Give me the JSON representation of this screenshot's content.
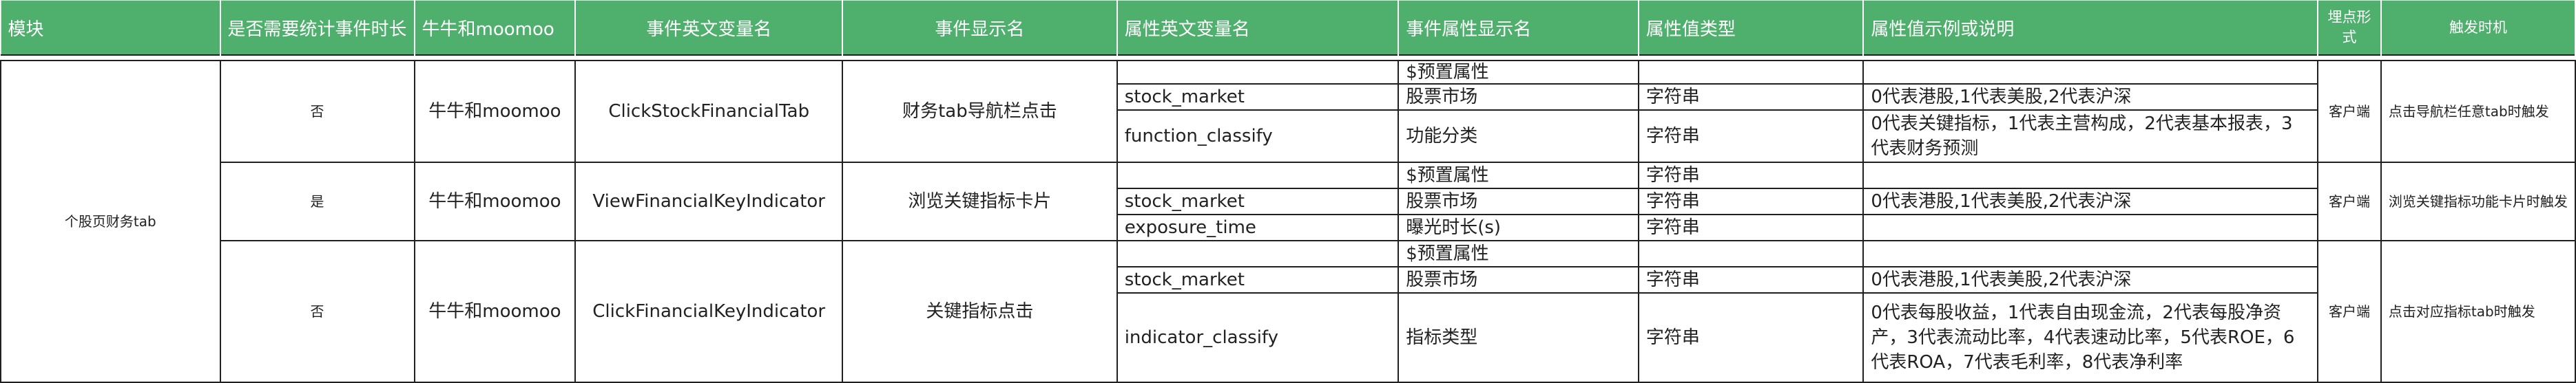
{
  "headers": {
    "module": "模块",
    "need_duration": "是否需要统计事件时长",
    "product": "牛牛和moomoo",
    "event_var": "事件英文变量名",
    "event_name": "事件显示名",
    "prop_var": "属性英文变量名",
    "prop_name": "事件属性显示名",
    "value_type": "属性值类型",
    "value_example": "属性值示例或说明",
    "track_form": "埋点形式",
    "trigger": "触发时机"
  },
  "module_name": "个股页财务tab",
  "events": [
    {
      "need_duration": "否",
      "product": "牛牛和moomoo",
      "event_var": "ClickStockFinancialTab",
      "event_name": "财务tab导航栏点击",
      "track_form": "客户端",
      "trigger": "点击导航栏任意tab时触发",
      "props": [
        {
          "var": "",
          "name": "$预置属性",
          "type": "",
          "example": ""
        },
        {
          "var": "stock_market",
          "name": "股票市场",
          "type": "字符串",
          "example": "0代表港股,1代表美股,2代表沪深"
        },
        {
          "var": "function_classify",
          "name": "功能分类",
          "type": "字符串",
          "example": "0代表关键指标，1代表主营构成，2代表基本报表，3代表财务预测"
        }
      ]
    },
    {
      "need_duration": "是",
      "product": "牛牛和moomoo",
      "event_var": "ViewFinancialKeyIndicator",
      "event_name": "浏览关键指标卡片",
      "track_form": "客户端",
      "trigger": "浏览关键指标功能卡片时触发",
      "props": [
        {
          "var": "",
          "name": "$预置属性",
          "type": "字符串",
          "example": ""
        },
        {
          "var": "stock_market",
          "name": "股票市场",
          "type": "字符串",
          "example": "0代表港股,1代表美股,2代表沪深"
        },
        {
          "var": "exposure_time",
          "name": "曝光时长(s)",
          "type": "字符串",
          "example": ""
        }
      ]
    },
    {
      "need_duration": "否",
      "product": "牛牛和moomoo",
      "event_var": "ClickFinancialKeyIndicator",
      "event_name": "关键指标点击",
      "track_form": "客户端",
      "trigger": "点击对应指标tab时触发",
      "props": [
        {
          "var": "",
          "name": "$预置属性",
          "type": "",
          "example": ""
        },
        {
          "var": "stock_market",
          "name": "股票市场",
          "type": "字符串",
          "example": "0代表港股,1代表美股,2代表沪深"
        },
        {
          "var": "indicator_classify",
          "name": "指标类型",
          "type": "字符串",
          "example": "0代表每股收益，1代表自由现金流，2代表每股净资产，3代表流动比率，4代表速动比率，5代表ROE，6代表ROA，7代表毛利率，8代表净利率"
        }
      ]
    }
  ]
}
